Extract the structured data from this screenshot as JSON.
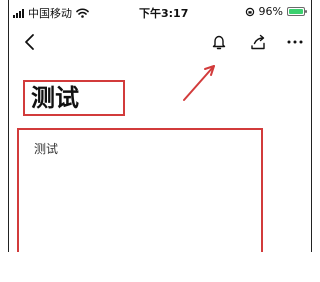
{
  "status_bar": {
    "carrier": "中国移动",
    "time": "下午3:17",
    "battery": "96%",
    "battery_level": 0.96
  },
  "nav": {
    "back_icon": "chevron-left-icon",
    "bell_icon": "bell-icon",
    "share_icon": "share-icon",
    "more_icon": "more-horizontal-icon"
  },
  "page": {
    "title": "测试",
    "content": "测试"
  },
  "colors": {
    "highlight": "#d23b3b",
    "battery": "#3bd16f"
  }
}
